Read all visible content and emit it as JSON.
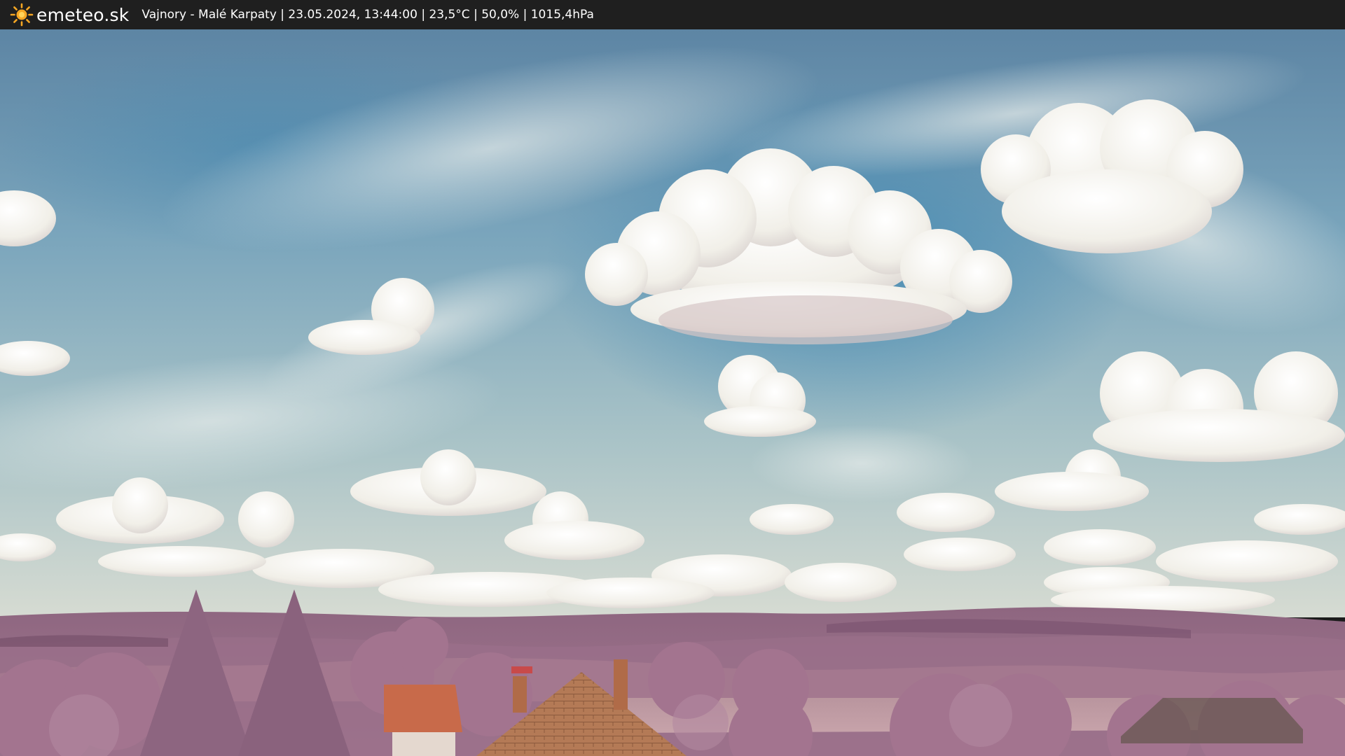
{
  "header": {
    "brand": "emeteo.sk",
    "info": "Vajnory - Malé Karpaty | 23.05.2024, 13:44:00 | 23,5°C | 50,0% | 1015,4hPa",
    "logo_icon": "sun-icon"
  },
  "colors": {
    "topbar": "#1f1f1f",
    "sun": "#f5a623",
    "sky_top": "#5f87a6",
    "sky_mid": "#7fa9bd",
    "sky_horizon": "#c9d4cf",
    "foliage": "#a0708e",
    "roof": "#c86a4a"
  }
}
